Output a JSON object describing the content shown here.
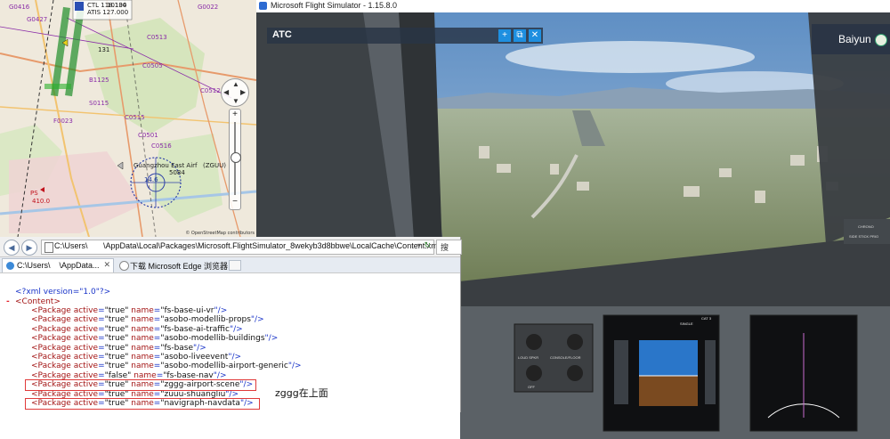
{
  "map": {
    "labels": {
      "atis": "ATIS 127.000",
      "ctl": "CTL 118.100",
      "freq": "10134",
      "apt_code": "131",
      "airport_name": "Guangzhou East Airf",
      "apt_id": "(ZGUU)",
      "elev": "5084",
      "radius": "14.6",
      "ps": "PS",
      "alt": "410.0",
      "w1": "G0427",
      "w2": "G0416",
      "w3": "G0022",
      "w4": "C0513",
      "w5": "C0505",
      "w6": "C0512",
      "w7": "S0115",
      "w8": "C0515",
      "w9": "B1125",
      "w10": "F0023",
      "w11": "C0501",
      "w12": "C0516"
    },
    "credit": "© OpenStreetMap contributors"
  },
  "flightsim": {
    "window_title": "Microsoft Flight Simulator - 1.15.8.0",
    "atc_label": "ATC",
    "atc_add": "+",
    "atc_popout": "⧉",
    "atc_close": "✕",
    "location_label": "Baiyun",
    "cockpit_labels": {
      "chrono": "CHRONO",
      "side_stick": "SIDE STICK PRIO",
      "single": "SINGLE",
      "cat": "CAT 3",
      "loud": "LOUD SPKR",
      "console": "CONSOLE/FLOOR",
      "off": "OFF"
    }
  },
  "browser": {
    "address": "C:\\Users\\       \\AppData\\Local\\Packages\\Microsoft.FlightSimulator_8wekyb3d8bbwe\\LocalCache\\Content.xml",
    "search_placeholder": "搜",
    "tab_active": "C:\\Users\\    \\AppData...",
    "tab_inactive": "下载 Microsoft Edge 浏览器 ...",
    "xml_decl": "<?xml version=\"1.0\"?>",
    "minus": "-",
    "content_open": "<Content>",
    "packages": [
      {
        "active": "true",
        "name": "fs-base-ui-vr"
      },
      {
        "active": "true",
        "name": "asobo-modellib-props"
      },
      {
        "active": "true",
        "name": "fs-base-ai-traffic"
      },
      {
        "active": "true",
        "name": "asobo-modellib-buildings"
      },
      {
        "active": "true",
        "name": "fs-base"
      },
      {
        "active": "true",
        "name": "asobo-liveevent"
      },
      {
        "active": "true",
        "name": "asobo-modellib-airport-generic"
      },
      {
        "active": "false",
        "name": "fs-base-nav"
      },
      {
        "active": "true",
        "name": "zggg-airport-scene"
      },
      {
        "active": "true",
        "name": "zuuu-shuangliu"
      },
      {
        "active": "true",
        "name": "navigraph-navdata"
      }
    ],
    "tokens": {
      "pkg_open": "<Package ",
      "attr_active": "active",
      "attr_name": "name",
      "eq": "=",
      "close": "\"/>"
    }
  },
  "annotation": "zggg在上面"
}
